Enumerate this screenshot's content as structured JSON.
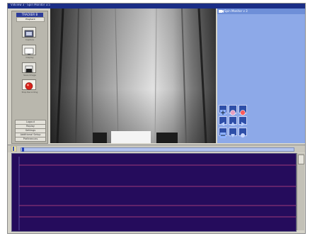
{
  "window": {
    "title": "Vidview 3 · Spin Monitor 3.5"
  },
  "left_panel": {
    "tab_label": "TRACKER B",
    "sub_label": "Playback",
    "tools": [
      {
        "icon": "video-capture-icon",
        "label": "Capture"
      },
      {
        "icon": "monitor-icon",
        "label": "Display"
      },
      {
        "icon": "save-image-icon",
        "label": "Save Image"
      },
      {
        "icon": "stop-record-icon",
        "label": "Stop Recording"
      }
    ],
    "buttons": [
      "Logout",
      "Replay",
      "Settings",
      "Additional Setup",
      "Preferences"
    ]
  },
  "right_panel": {
    "header": "Spin Monitor v 3"
  },
  "graph": {
    "line_color": "#c84a84",
    "background": "#250c5c"
  }
}
